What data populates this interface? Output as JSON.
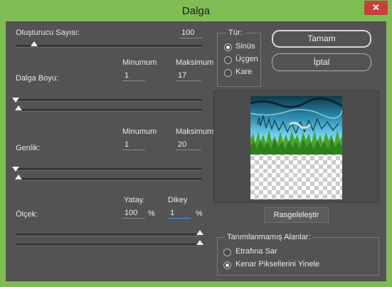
{
  "window": {
    "title": "Dalga",
    "close_glyph": "✕"
  },
  "generators": {
    "label": "Oluşturucu Sayısı:",
    "value": "100",
    "slider_fraction": 0.1
  },
  "wavelength": {
    "label": "Dalga Boyu:",
    "min_header": "Minumum",
    "max_header": "Maksimum",
    "min_value": "1",
    "max_value": "17"
  },
  "amplitude": {
    "label": "Genlik:",
    "min_header": "Minumum",
    "max_header": "Maksimum",
    "min_value": "1",
    "max_value": "20"
  },
  "scale": {
    "label": "Ölçek:",
    "horiz_header": "Yatay.",
    "vert_header": "Dikey",
    "horiz_value": "100",
    "vert_value": "1",
    "unit": "%"
  },
  "type_group": {
    "title": "Tür:",
    "options": [
      "Sinüs",
      "Üçgen",
      "Kare"
    ],
    "selected": "Sinüs"
  },
  "buttons": {
    "ok": "Tamam",
    "cancel": "İptal",
    "randomize": "Rasgeleleştir"
  },
  "undefined_areas": {
    "title": "Tanımlanmamış Alanlar:",
    "options": [
      "Etrafına Sar",
      "Kenar Piksellerini Yinele"
    ],
    "selected": "Kenar Piksellerini Yinele"
  },
  "colors": {
    "window_frame": "#7fbd54",
    "dialog_bg": "#535353",
    "close_button": "#c7413a",
    "focus_underline": "#4a90e2"
  }
}
